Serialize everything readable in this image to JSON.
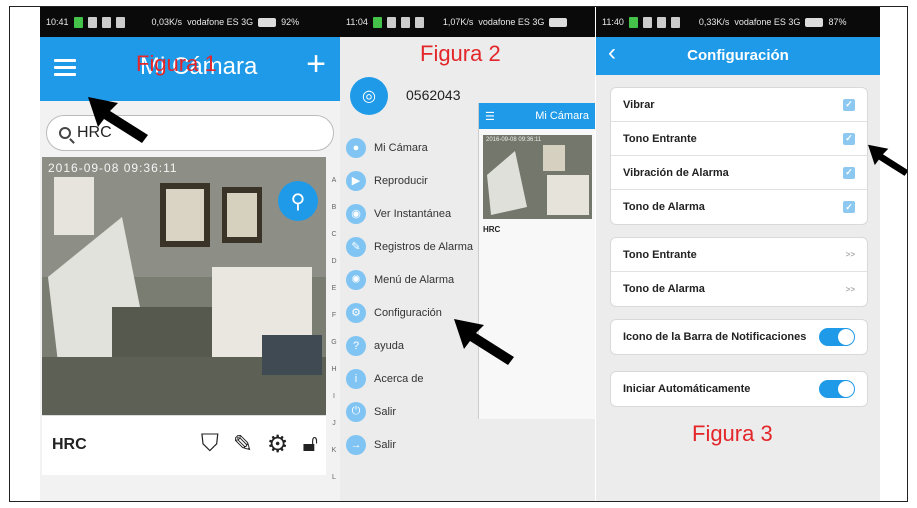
{
  "fig1": {
    "label": "Figura 1",
    "status": {
      "time": "10:41",
      "speed": "0,03K/s",
      "carrier": "vodafone ES 3G",
      "battery": "92%"
    },
    "title": "Mi Cámara",
    "search_value": "HRC",
    "cam_timestamp": "2016-09-08  09:36:11",
    "alphabet": [
      "A",
      "B",
      "C",
      "D",
      "E",
      "F",
      "G",
      "H",
      "I",
      "J",
      "K",
      "L"
    ],
    "camera_name": "HRC"
  },
  "fig2": {
    "label": "Figura 2",
    "status": {
      "time": "11:04",
      "speed": "1,07K/s",
      "carrier": "vodafone ES 3G",
      "battery": "90%"
    },
    "user_id": "0562043",
    "menu": [
      {
        "label": "Mi Cámara",
        "icon": "people-icon"
      },
      {
        "label": "Reproducir",
        "icon": "playback-icon"
      },
      {
        "label": "Ver Instantánea",
        "icon": "snapshot-icon"
      },
      {
        "label": "Registros de Alarma",
        "icon": "pencil-icon"
      },
      {
        "label": "Menú de Alarma",
        "icon": "alarm-icon"
      },
      {
        "label": "Configuración",
        "icon": "gears-icon"
      },
      {
        "label": "ayuda",
        "icon": "help-icon"
      },
      {
        "label": "Acerca de",
        "icon": "info-icon"
      },
      {
        "label": "Salir",
        "icon": "power-icon"
      },
      {
        "label": "Salir",
        "icon": "exit-icon"
      }
    ],
    "preview_title": "Mi Cámara",
    "preview_name": "HRC"
  },
  "fig3": {
    "label": "Figura 3",
    "status": {
      "time": "11:40",
      "speed": "0,33K/s",
      "carrier": "vodafone ES 3G",
      "battery": "87%"
    },
    "title": "Configuración",
    "checkboxes": [
      "Vibrar",
      "Tono Entrante",
      "Vibración de Alarma",
      "Tono de Alarma"
    ],
    "links": [
      "Tono Entrante",
      "Tono de Alarma"
    ],
    "toggle_notif": "Icono de la Barra de Notificaciones",
    "toggle_auto": "Iniciar Automáticamente"
  },
  "colors": {
    "accent": "#1f9ae8",
    "label_red": "#e3262a"
  }
}
